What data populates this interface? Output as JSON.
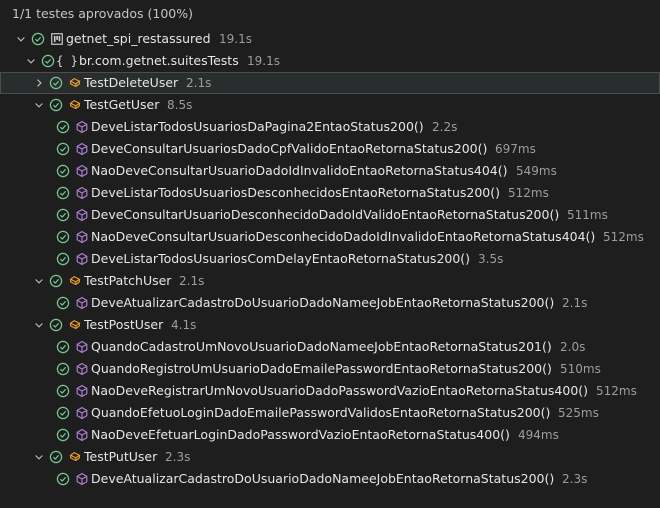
{
  "summary": "1/1 testes aprovados (100%)",
  "colors": {
    "pass": "#73c991",
    "method_icon": "#b180d7",
    "class_icon": "#ee9d28"
  },
  "tree": [
    {
      "depth": 0,
      "expanded": true,
      "kind": "project",
      "label": "getnet_spi_restassured",
      "duration": "19.1s"
    },
    {
      "depth": 1,
      "expanded": true,
      "kind": "package",
      "label": "br.com.getnet.suitesTests",
      "duration": "19.1s"
    },
    {
      "depth": 2,
      "expanded": false,
      "kind": "class",
      "label": "TestDeleteUser",
      "duration": "2.1s",
      "selected": true
    },
    {
      "depth": 2,
      "expanded": true,
      "kind": "class",
      "label": "TestGetUser",
      "duration": "8.5s"
    },
    {
      "depth": 3,
      "kind": "method",
      "label": "DeveListarTodosUsuariosDaPagina2EntaoStatus200()",
      "duration": "2.2s"
    },
    {
      "depth": 3,
      "kind": "method",
      "label": "DeveConsultarUsuariosDadoCpfValidoEntaoRetornaStatus200()",
      "duration": "697ms"
    },
    {
      "depth": 3,
      "kind": "method",
      "label": "NaoDeveConsultarUsuarioDadoIdInvalidoEntaoRetornaStatus404()",
      "duration": "549ms"
    },
    {
      "depth": 3,
      "kind": "method",
      "label": "DeveListarTodosUsuariosDesconhecidosEntaoRetornaStatus200()",
      "duration": "512ms"
    },
    {
      "depth": 3,
      "kind": "method",
      "label": "DeveConsultarUsuarioDesconhecidoDadoIdValidoEntaoRetornaStatus200()",
      "duration": "511ms"
    },
    {
      "depth": 3,
      "kind": "method",
      "label": "NaoDeveConsultarUsuarioDesconhecidoDadoIdInvalidoEntaoRetornaStatus404()",
      "duration": "512ms"
    },
    {
      "depth": 3,
      "kind": "method",
      "label": "DeveListarTodosUsuariosComDelayEntaoRetornaStatus200()",
      "duration": "3.5s"
    },
    {
      "depth": 2,
      "expanded": true,
      "kind": "class",
      "label": "TestPatchUser",
      "duration": "2.1s"
    },
    {
      "depth": 3,
      "kind": "method",
      "label": "DeveAtualizarCadastroDoUsuarioDadoNameeJobEntaoRetornaStatus200()",
      "duration": "2.1s"
    },
    {
      "depth": 2,
      "expanded": true,
      "kind": "class",
      "label": "TestPostUser",
      "duration": "4.1s"
    },
    {
      "depth": 3,
      "kind": "method",
      "label": "QuandoCadastroUmNovoUsuarioDadoNameeJobEntaoRetornaStatus201()",
      "duration": "2.0s"
    },
    {
      "depth": 3,
      "kind": "method",
      "label": "QuandoRegistroUmUsuarioDadoEmailePasswordEntaoRetornaStatus200()",
      "duration": "510ms"
    },
    {
      "depth": 3,
      "kind": "method",
      "label": "NaoDeveRegistrarUmNovoUsuarioDadoPasswordVazioEntaoRetornaStatus400()",
      "duration": "512ms"
    },
    {
      "depth": 3,
      "kind": "method",
      "label": "QuandoEfetuoLoginDadoEmailePasswordValidosEntaoRetornaStatus200()",
      "duration": "525ms"
    },
    {
      "depth": 3,
      "kind": "method",
      "label": "NaoDeveEfetuarLoginDadoPasswordVazioEntaoRetornaStatus400()",
      "duration": "494ms"
    },
    {
      "depth": 2,
      "expanded": true,
      "kind": "class",
      "label": "TestPutUser",
      "duration": "2.3s"
    },
    {
      "depth": 3,
      "kind": "method",
      "label": "DeveAtualizarCadastroDoUsuarioDadoNameeJobEntaoRetornaStatus200()",
      "duration": "2.3s"
    }
  ]
}
